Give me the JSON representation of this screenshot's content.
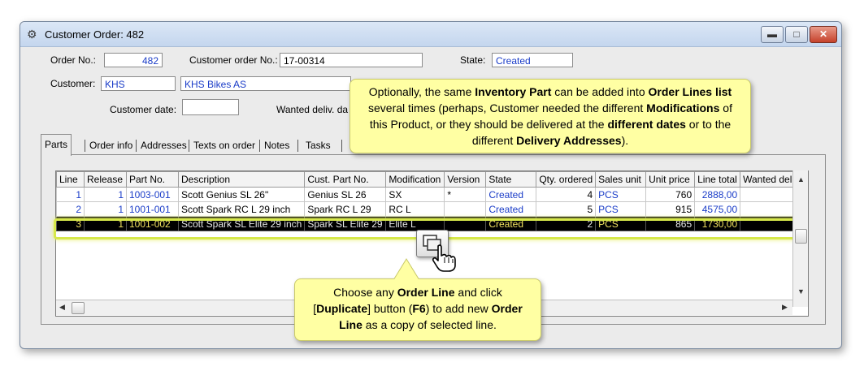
{
  "window": {
    "title": "Customer Order: 482",
    "controls": {
      "minimize": "▬",
      "maximize": "□",
      "close": "✕"
    }
  },
  "header": {
    "order_no_label": "Order No.:",
    "order_no_value": "482",
    "customer_order_no_label": "Customer order No.:",
    "customer_order_no_value": "17-00314",
    "state_label": "State:",
    "state_value": "Created",
    "customer_label": "Customer:",
    "customer_code": "KHS",
    "customer_name": "KHS Bikes AS",
    "customer_date_label": "Customer date:",
    "customer_date_value": "",
    "wanted_deliv_label": "Wanted deliv. da"
  },
  "tabs": [
    "Parts",
    "Order info",
    "Addresses",
    "Texts on order",
    "Notes",
    "Tasks"
  ],
  "grid": {
    "columns": [
      "Line",
      "Release",
      "Part No.",
      "Description",
      "Cust. Part No.",
      "Modification",
      "Version",
      "State",
      "Qty. ordered",
      "Sales unit",
      "Unit price",
      "Line total",
      "Wanted deliv"
    ],
    "rows": [
      [
        "1",
        "1",
        "1003-001",
        "Scott Genius SL 26\"",
        "Genius SL 26",
        "SX",
        "*",
        "Created",
        "4",
        "PCS",
        "760",
        "2888,00",
        ""
      ],
      [
        "2",
        "1",
        "1001-001",
        "Scott Spark RC L 29 inch",
        "Spark RC L 29",
        "RC L",
        "",
        "Created",
        "5",
        "PCS",
        "915",
        "4575,00",
        ""
      ],
      [
        "3",
        "1",
        "1001-002",
        "Scott Spark SL Elite 29 inch",
        "Spark SL Elite 29",
        "Elite L",
        "",
        "Created",
        "2",
        "PCS",
        "865",
        "1730,00",
        ""
      ]
    ],
    "selected_row": 3
  },
  "callouts": {
    "top": {
      "p1": "Optionally, the same ",
      "b1": "Inventory Part",
      "p2": " can be added into ",
      "b2": "Order Lines list",
      "p3": " several times (perhaps, Customer needed the different ",
      "b3": "Modifications",
      "p4": " of this Product, or they should be delivered at the ",
      "b4": "different dates",
      "p5": " or to the different ",
      "b5": "Delivery Addresses",
      "p6": ")."
    },
    "bottom": {
      "p1": "Choose any ",
      "b1": "Order Line",
      "p2": " and click [",
      "b2": "Duplicate",
      "p3": "] button (",
      "b3": "F6",
      "p4": ") to add new ",
      "b4": "Order Line",
      "p5": " as a copy of selected line."
    }
  },
  "icons": {
    "window_icon": "gear-icon",
    "duplicate_button": "duplicate-icon",
    "cursor": "hand-pointer-icon"
  },
  "colors": {
    "field_text": "#1a3cc8",
    "callout_bg": "#ffffa3",
    "selection_glow": "#d6e84a"
  }
}
